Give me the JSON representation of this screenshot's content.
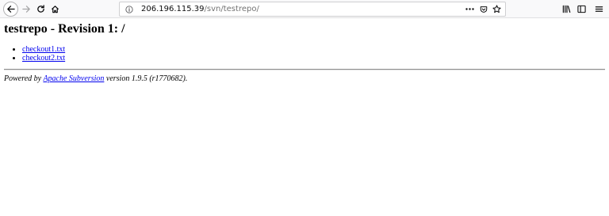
{
  "browser": {
    "url_host": "206.196.115.39",
    "url_path": "/svn/testrepo/"
  },
  "page": {
    "title": "testrepo - Revision 1: /",
    "files": [
      "checkout1.txt",
      "checkout2.txt"
    ],
    "footer": {
      "prefix": "Powered by ",
      "link": "Apache Subversion",
      "suffix": " version 1.9.5 (r1770682)."
    }
  }
}
